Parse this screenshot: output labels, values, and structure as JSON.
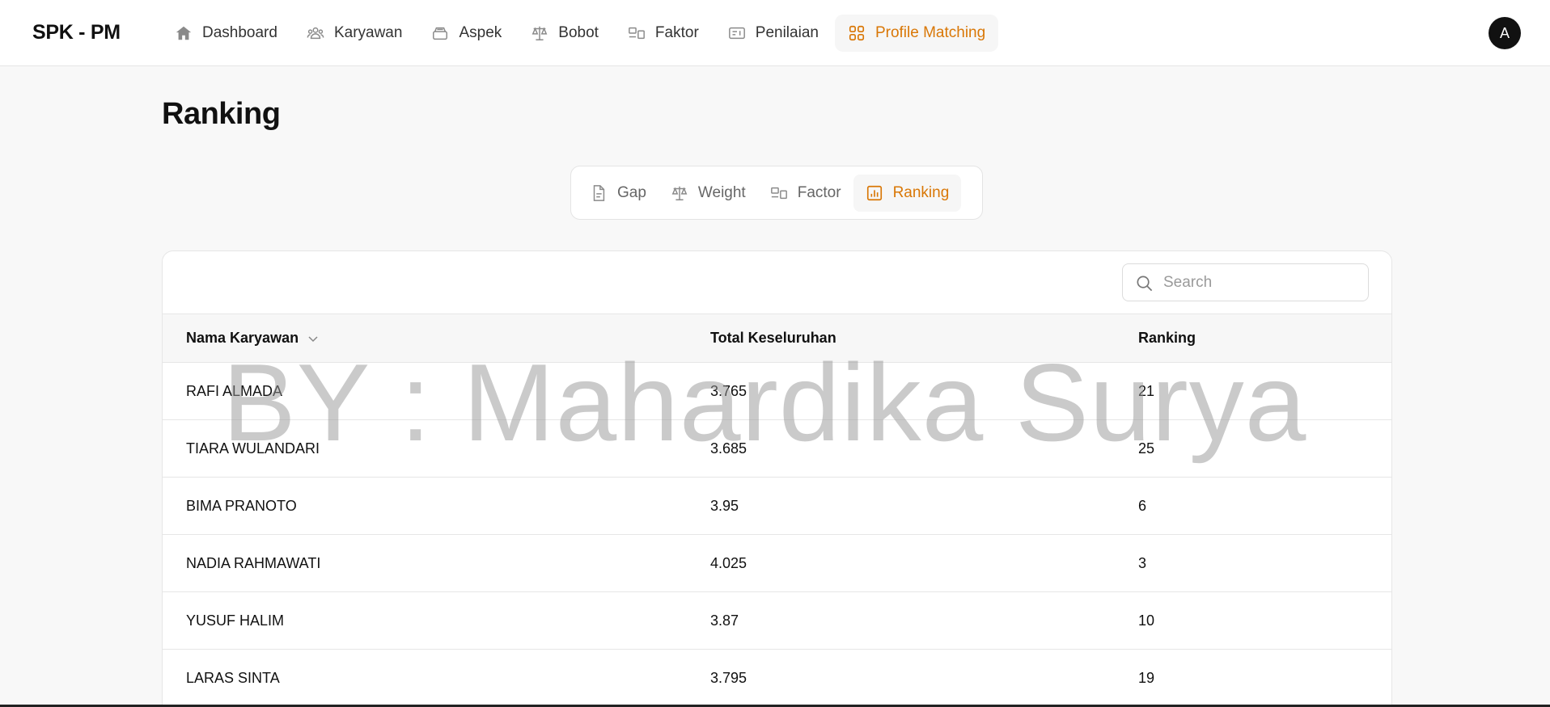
{
  "brand": "SPK - PM",
  "nav": {
    "items": [
      {
        "label": "Dashboard",
        "icon": "home-icon"
      },
      {
        "label": "Karyawan",
        "icon": "users-icon"
      },
      {
        "label": "Aspek",
        "icon": "layers-icon"
      },
      {
        "label": "Bobot",
        "icon": "scale-icon"
      },
      {
        "label": "Faktor",
        "icon": "factor-icon"
      },
      {
        "label": "Penilaian",
        "icon": "ticket-icon"
      },
      {
        "label": "Profile Matching",
        "icon": "grid-icon",
        "active": true
      }
    ],
    "avatar": "A"
  },
  "page": {
    "title": "Ranking"
  },
  "subtabs": [
    {
      "label": "Gap",
      "icon": "document-icon"
    },
    {
      "label": "Weight",
      "icon": "scale-icon"
    },
    {
      "label": "Factor",
      "icon": "factor-icon"
    },
    {
      "label": "Ranking",
      "icon": "bar-chart-icon",
      "active": true
    }
  ],
  "search": {
    "placeholder": "Search",
    "value": ""
  },
  "table": {
    "headers": [
      "Nama Karyawan",
      "Total Keseluruhan",
      "Ranking"
    ],
    "sort_icon": "chevron-down-icon",
    "rows": [
      {
        "name": "RAFI ALMADA",
        "total": "3.765",
        "rank": "21"
      },
      {
        "name": "TIARA WULANDARI",
        "total": "3.685",
        "rank": "25"
      },
      {
        "name": "BIMA PRANOTO",
        "total": "3.95",
        "rank": "6"
      },
      {
        "name": "NADIA RAHMAWATI",
        "total": "4.025",
        "rank": "3"
      },
      {
        "name": "YUSUF HALIM",
        "total": "3.87",
        "rank": "10"
      },
      {
        "name": "LARAS SINTA",
        "total": "3.795",
        "rank": "19"
      }
    ]
  },
  "watermark": "BY : Mahardika Surya",
  "colors": {
    "accent": "#d97706",
    "text": "#111111",
    "muted": "#666666",
    "background": "#f8f8f8"
  }
}
